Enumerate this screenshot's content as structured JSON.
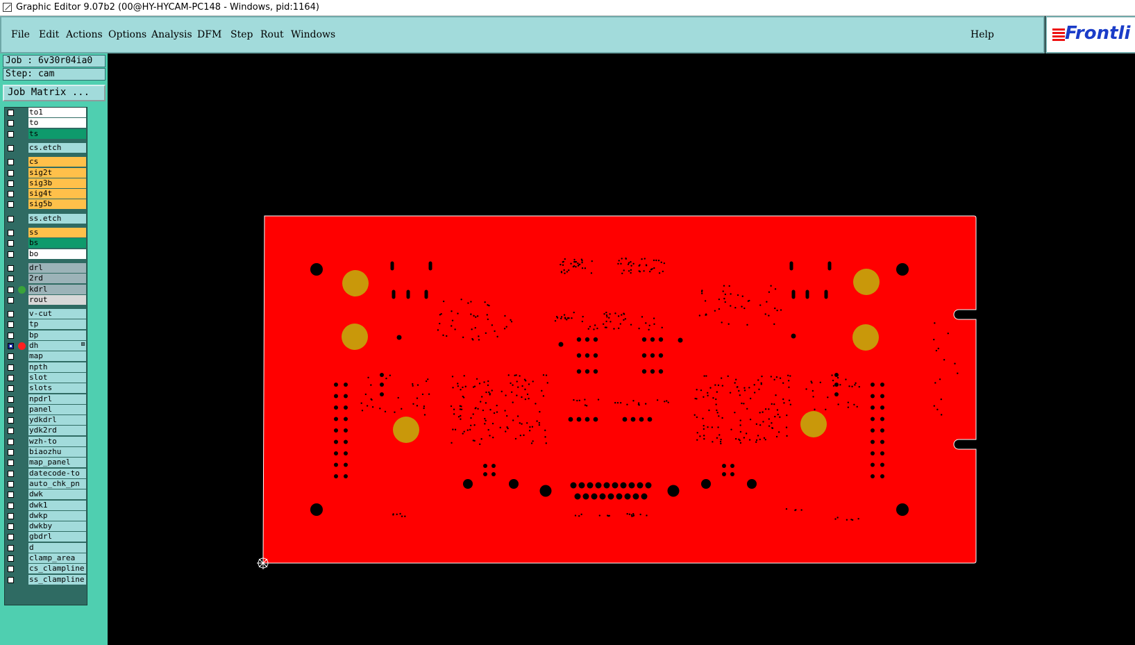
{
  "window": {
    "title": "Graphic Editor 9.07b2 (00@HY-HYCAM-PC148 - Windows, pid:1164)"
  },
  "menu": {
    "items": [
      "File",
      "Edit",
      "Actions",
      "Options",
      "Analysis",
      "DFM",
      "Step",
      "Rout",
      "Windows"
    ],
    "help": "Help"
  },
  "logo": {
    "text": "Frontli"
  },
  "job": {
    "label": "Job : 6v30r04ia0",
    "step": "Step: cam",
    "matrix_button": "Job Matrix ..."
  },
  "colors": {
    "board": "#ff0000",
    "hole": "#000000",
    "pad_gold": "#c9980a",
    "menu_bg": "#a2dbdb",
    "sidebar_bg": "#4fcfb0"
  },
  "layers": [
    {
      "name": "to1",
      "color": "#ffffff"
    },
    {
      "name": "to",
      "color": "#ffffff"
    },
    {
      "name": "ts",
      "color": "#0e9a6c"
    },
    {
      "name": "cs.etch",
      "color": "#a2dbdb",
      "gap": true
    },
    {
      "name": "cs",
      "color": "#ffc04a",
      "gap": true
    },
    {
      "name": "sig2t",
      "color": "#ffc04a"
    },
    {
      "name": "sig3b",
      "color": "#ffc04a"
    },
    {
      "name": "sig4t",
      "color": "#ffc04a"
    },
    {
      "name": "sig5b",
      "color": "#ffc04a"
    },
    {
      "name": "ss.etch",
      "color": "#a2dbdb",
      "gap": true
    },
    {
      "name": "ss",
      "color": "#ffc04a",
      "gap": true
    },
    {
      "name": "bs",
      "color": "#0e9a6c"
    },
    {
      "name": "bo",
      "color": "#ffffff"
    },
    {
      "name": "drl",
      "color": "#9cb3b8",
      "gap": true
    },
    {
      "name": "2rd",
      "color": "#9cb3b8"
    },
    {
      "name": "kdrl",
      "color": "#9cb3b8",
      "indicator": "#3aa33a"
    },
    {
      "name": "rout",
      "color": "#d8d8d8"
    },
    {
      "name": "v-cut",
      "color": "#a2dbdb",
      "gap": true
    },
    {
      "name": "tp",
      "color": "#a2dbdb"
    },
    {
      "name": "bp",
      "color": "#a2dbdb"
    },
    {
      "name": "dh",
      "color": "#a2dbdb",
      "indicator": "#ff2020",
      "selected": true,
      "extra": "⊞"
    },
    {
      "name": "map",
      "color": "#a2dbdb"
    },
    {
      "name": "npth",
      "color": "#a2dbdb"
    },
    {
      "name": "slot",
      "color": "#a2dbdb"
    },
    {
      "name": "slots",
      "color": "#a2dbdb"
    },
    {
      "name": "npdrl",
      "color": "#a2dbdb"
    },
    {
      "name": "panel",
      "color": "#a2dbdb"
    },
    {
      "name": "ydkdrl",
      "color": "#a2dbdb"
    },
    {
      "name": "ydk2rd",
      "color": "#a2dbdb"
    },
    {
      "name": "wzh-to",
      "color": "#a2dbdb"
    },
    {
      "name": "biaozhu",
      "color": "#a2dbdb"
    },
    {
      "name": "map_panel",
      "color": "#a2dbdb"
    },
    {
      "name": "datecode-to",
      "color": "#a2dbdb"
    },
    {
      "name": "auto_chk_pn",
      "color": "#a2dbdb"
    },
    {
      "name": "dwk",
      "color": "#a2dbdb"
    },
    {
      "name": "dwk1",
      "color": "#a2dbdb"
    },
    {
      "name": "dwkp",
      "color": "#a2dbdb"
    },
    {
      "name": "dwkby",
      "color": "#a2dbdb"
    },
    {
      "name": "gbdrl",
      "color": "#a2dbdb"
    },
    {
      "name": "d",
      "color": "#a2dbdb"
    },
    {
      "name": "clamp_area",
      "color": "#a2dbdb"
    },
    {
      "name": "cs_clampline",
      "color": "#a2dbdb"
    },
    {
      "name": "ss_clampline",
      "color": "#a2dbdb"
    }
  ]
}
